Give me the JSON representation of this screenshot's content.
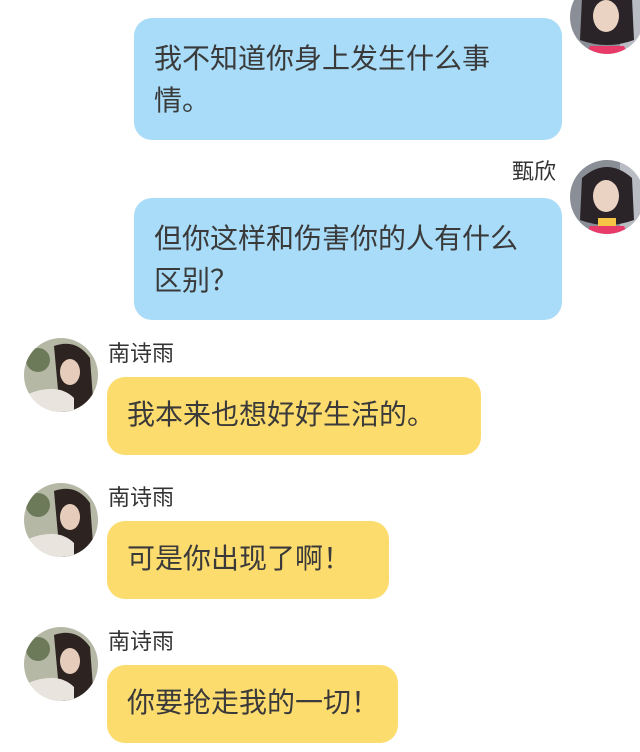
{
  "conversation": {
    "messages": [
      {
        "sender": "甄欣",
        "side": "right",
        "text": "我不知道你身上发生什么事情。",
        "name_visible": false
      },
      {
        "sender": "甄欣",
        "side": "right",
        "text": "但你这样和伤害你的人有什么区别？",
        "name_visible": true
      },
      {
        "sender": "南诗雨",
        "side": "left",
        "text": "我本来也想好好生活的。",
        "name_visible": true
      },
      {
        "sender": "南诗雨",
        "side": "left",
        "text": "可是你出现了啊！",
        "name_visible": true
      },
      {
        "sender": "南诗雨",
        "side": "left",
        "text": "你要抢走我的一切！",
        "name_visible": true
      }
    ]
  },
  "colors": {
    "right_bubble": "#a8dcf8",
    "left_bubble": "#fddc6e",
    "text": "#3a3a3a",
    "name": "#333333"
  }
}
